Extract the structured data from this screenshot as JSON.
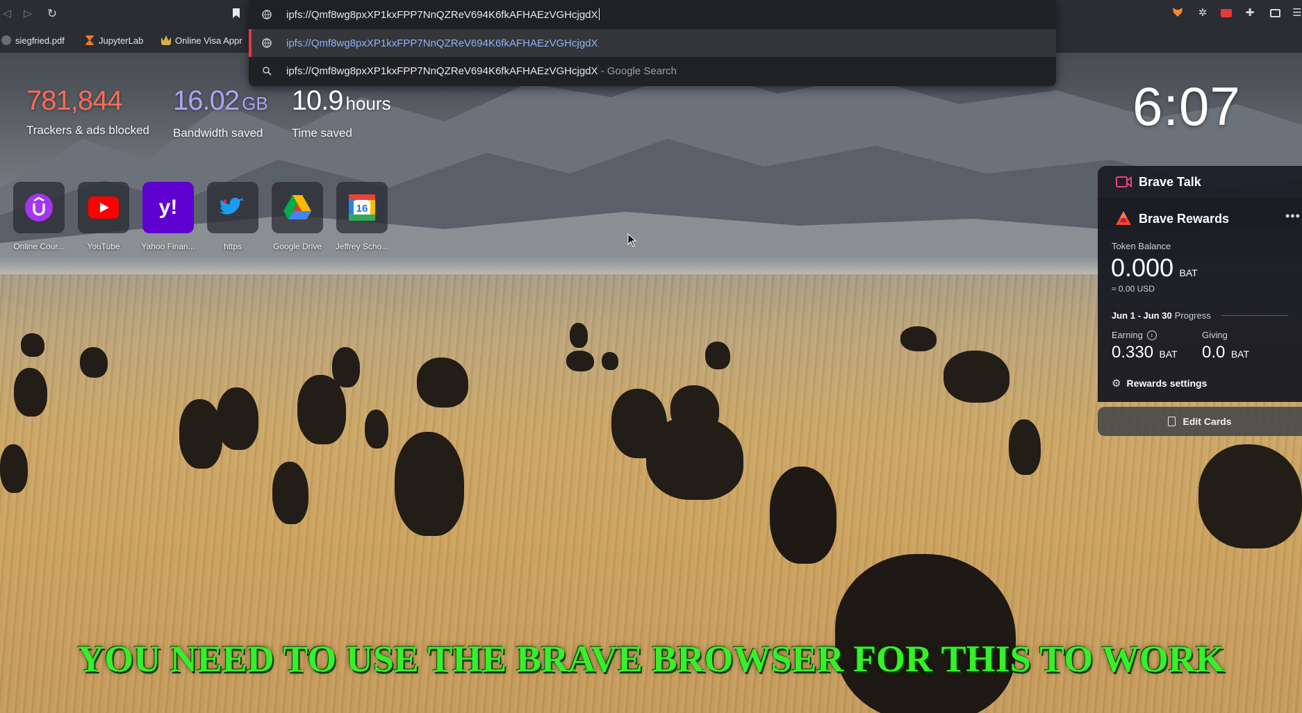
{
  "browser": {
    "address_bar": {
      "value": "ipfs://Qmf8wg8pxXP1kxFPP7NnQZReV694K6fkAFHAEzVGHcjgdX"
    },
    "suggestions": [
      {
        "text": "ipfs://Qmf8wg8pxXP1kxFPP7NnQZReV694K6fkAFHAEzVGHcjgdX",
        "suffix": "",
        "icon": "globe-icon"
      },
      {
        "text": "ipfs://Qmf8wg8pxXP1kxFPP7NnQZReV694K6fkAFHAEzVGHcjgdX",
        "suffix": "- Google Search",
        "icon": "search-icon"
      }
    ],
    "bookmarks": [
      {
        "label": "siegfried.pdf",
        "icon": "globe-icon"
      },
      {
        "label": "JupyterLab",
        "icon": "hourglass-icon"
      },
      {
        "label": "Online Visa Appr",
        "icon": "crown-icon"
      }
    ],
    "extensions": [
      "brave-wallet-fox-icon",
      "settings-cog-icon",
      "extension-red-icon",
      "puzzle-icon",
      "wallet-icon",
      "menu-icon"
    ]
  },
  "stats": [
    {
      "value": "781,844",
      "unit": "",
      "label": "Trackers & ads blocked",
      "color": "#ff6b52"
    },
    {
      "value": "16.02",
      "unit": "GB",
      "label": "Bandwidth saved",
      "color": "#a8a6f5"
    },
    {
      "value": "10.9",
      "unit": "hours",
      "label": "Time saved",
      "color": "#ffffff"
    }
  ],
  "clock": {
    "time": "6:07"
  },
  "top_sites": [
    {
      "label": "Online Cour...",
      "icon": "udemy-icon"
    },
    {
      "label": "YouTube",
      "icon": "youtube-icon"
    },
    {
      "label": "Yahoo Finan...",
      "icon": "yahoo-icon"
    },
    {
      "label": "https",
      "icon": "twitter-icon"
    },
    {
      "label": "Google Drive",
      "icon": "google-drive-icon"
    },
    {
      "label": "Jeffrey Scho...",
      "icon": "calendar-icon"
    }
  ],
  "brave_talk": {
    "title": "Brave Talk"
  },
  "rewards": {
    "title": "Brave Rewards",
    "token_balance_label": "Token Balance",
    "balance": "0.000",
    "balance_unit": "BAT",
    "usd": "≈ 0.00 USD",
    "period": "Jun 1 - Jun 30",
    "progress_label": "Progress",
    "earning_label": "Earning",
    "earning_value": "0.330",
    "earning_unit": "BAT",
    "giving_label": "Giving",
    "giving_value": "0.0",
    "giving_unit": "BAT",
    "settings_label": "Rewards settings"
  },
  "edit_cards": {
    "label": "Edit Cards"
  },
  "caption": {
    "text": "YOU NEED TO USE THE BRAVE BROWSER FOR THIS TO WORK"
  }
}
